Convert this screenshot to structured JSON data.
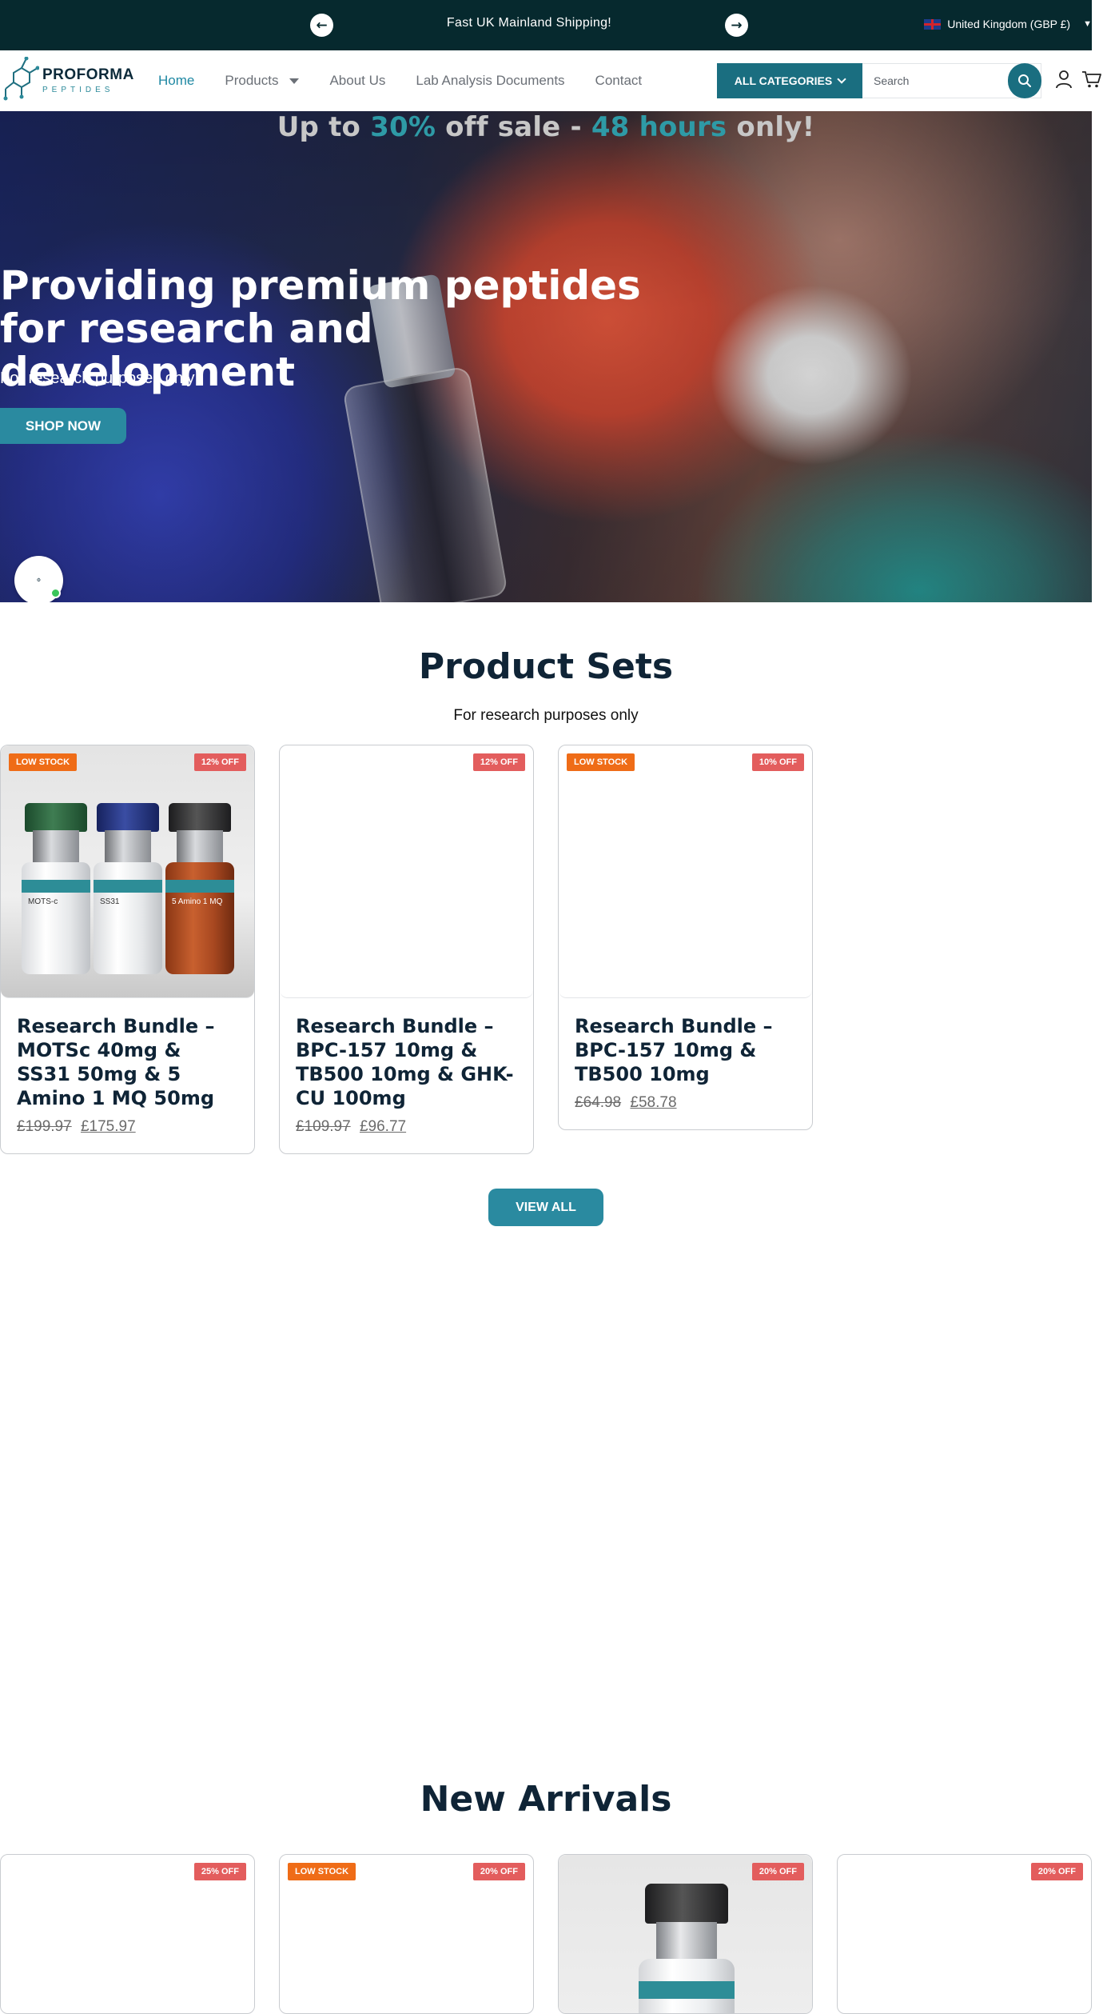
{
  "announcement": {
    "message": "Fast UK Mainland Shipping!",
    "country": "United Kingdom (GBP £)",
    "prev_icon": "arrow-left-icon",
    "next_icon": "arrow-right-icon"
  },
  "header": {
    "logo_name": "PROFORMA",
    "logo_sub": "PEPTIDES",
    "nav": [
      "Home",
      "Products",
      "About Us",
      "Lab Analysis Documents",
      "Contact"
    ],
    "all_categories": "ALL CATEGORIES",
    "search_placeholder": "Search"
  },
  "hero": {
    "sale_prefix": "Up to ",
    "sale_pct": "30%",
    "sale_mid": " off sale - ",
    "sale_hours": "48 hours",
    "sale_suffix": " only!",
    "headline": "Providing premium peptides for research and development",
    "subtext": "For research purposes only",
    "cta": "SHOP NOW"
  },
  "product_sets": {
    "title": "Product Sets",
    "subtitle": "For research purposes only",
    "view_all": "VIEW ALL",
    "products": [
      {
        "badge_stock": "LOW STOCK",
        "badge_off": "12% OFF",
        "title": "Research Bundle – MOTSc 40mg & SS31 50mg & 5 Amino 1 MQ 50mg",
        "old_price": "£199.97",
        "new_price": "£175.97",
        "bottle_labels": [
          "MOTS-c",
          "SS31",
          "5 Amino 1 MQ"
        ]
      },
      {
        "badge_stock": "",
        "badge_off": "12% OFF",
        "title": "Research Bundle – BPC-157 10mg & TB500 10mg & GHK-CU 100mg",
        "old_price": "£109.97",
        "new_price": "£96.77"
      },
      {
        "badge_stock": "LOW STOCK",
        "badge_off": "10% OFF",
        "title": "Research Bundle – BPC-157 10mg & TB500 10mg",
        "old_price": "£64.98",
        "new_price": "£58.78"
      }
    ]
  },
  "new_arrivals": {
    "title": "New Arrivals",
    "products": [
      {
        "badge_stock": "",
        "badge_off": "25% OFF"
      },
      {
        "badge_stock": "LOW STOCK",
        "badge_off": "20% OFF"
      },
      {
        "badge_stock": "",
        "badge_off": "20% OFF"
      },
      {
        "badge_stock": "",
        "badge_off": "20% OFF"
      }
    ]
  },
  "colors": {
    "announcement_bg": "#06292e",
    "accent": "#1a6e80",
    "button": "#2a8aa0",
    "badge_low_stock": "#ef6c17",
    "badge_discount": "#e35d5d"
  }
}
